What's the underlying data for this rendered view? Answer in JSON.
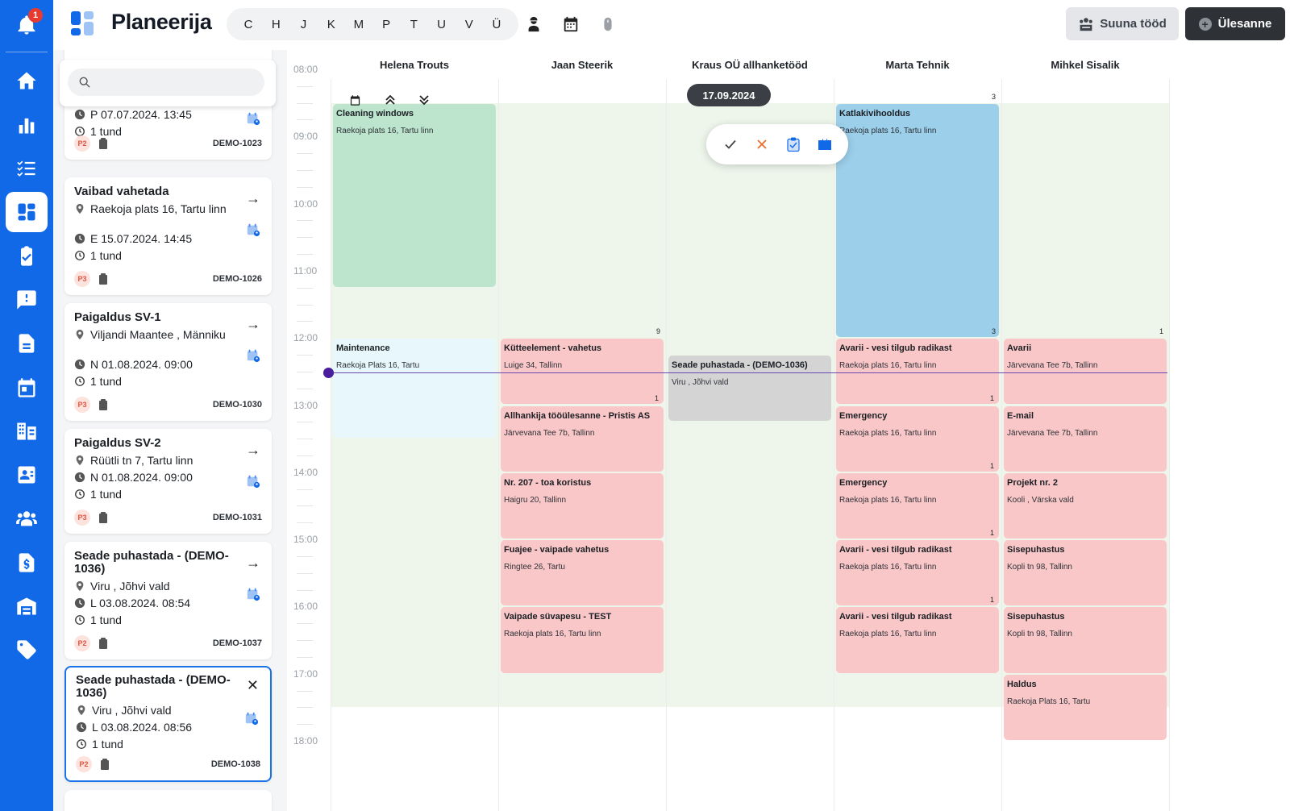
{
  "app": {
    "title": "Planeerija",
    "notification_count": "1"
  },
  "letters": [
    "C",
    "H",
    "J",
    "K",
    "M",
    "P",
    "T",
    "U",
    "V",
    "Ü"
  ],
  "toolbar": {
    "suuna_label": "Suuna tööd",
    "ulesanne_label": "Ülesanne"
  },
  "search": {
    "placeholder": ""
  },
  "tasks": [
    {
      "title": "",
      "address": "",
      "date": "P 07.07.2024. 13:45",
      "duration": "1 tund",
      "priority": "P2",
      "id": "DEMO-1023"
    },
    {
      "title": "Vaibad vahetada",
      "address": "Raekoja plats 16, Tartu linn",
      "date": "E 15.07.2024. 14:45",
      "duration": "1 tund",
      "priority": "P3",
      "id": "DEMO-1026"
    },
    {
      "title": "Paigaldus SV-1",
      "address": "Viljandi Maantee , Männiku",
      "date": "N 01.08.2024. 09:00",
      "duration": "1 tund",
      "priority": "P3",
      "id": "DEMO-1030"
    },
    {
      "title": "Paigaldus SV-2",
      "address": "Rüütli tn 7, Tartu linn",
      "date": "N 01.08.2024. 09:00",
      "duration": "1 tund",
      "priority": "P3",
      "id": "DEMO-1031"
    },
    {
      "title": "Seade puhastada - (DEMO-1036)",
      "address": "Viru , Jõhvi vald",
      "date": "L 03.08.2024. 08:54",
      "duration": "1 tund",
      "priority": "P2",
      "id": "DEMO-1037"
    },
    {
      "title": "Seade puhastada - (DEMO-1036)",
      "address": "Viru , Jõhvi vald",
      "date": "L 03.08.2024. 08:56",
      "duration": "1 tund",
      "priority": "P2",
      "id": "DEMO-1038"
    }
  ],
  "calendar": {
    "date": "17.09.2024",
    "times": [
      "08:00",
      "09:00",
      "10:00",
      "11:00",
      "12:00",
      "13:00",
      "14:00",
      "15:00",
      "16:00",
      "17:00",
      "18:00"
    ],
    "columns": [
      "Helena Trouts",
      "Jaan Steerik",
      "Kraus OÜ allhanketööd",
      "Marta Tehnik",
      "Mihkel Sisalik"
    ],
    "counts": {
      "top_marta": "3",
      "mid_jaan": "9",
      "mid_marta": "3",
      "mid_mihkel": "1"
    },
    "events": [
      {
        "col": 0,
        "start": 8.5,
        "end": 11.25,
        "color": "green",
        "title": "Cleaning windows",
        "address": "Raekoja plats 16, Tartu linn",
        "count": ""
      },
      {
        "col": 3,
        "start": 8.5,
        "end": 12.0,
        "color": "blue",
        "title": "Katlakivihooldus",
        "address": "Raekoja plats 16, Tartu linn",
        "count": ""
      },
      {
        "col": 0,
        "start": 12.0,
        "end": 13.5,
        "color": "lightblue",
        "title": "Maintenance",
        "address": "Raekoja Plats 16, Tartu",
        "count": ""
      },
      {
        "col": 1,
        "start": 12.0,
        "end": 13.0,
        "color": "red",
        "title": "Kütteelement - vahetus",
        "address": "Luige 34, Tallinn",
        "count": "1"
      },
      {
        "col": 1,
        "start": 13.0,
        "end": 14.0,
        "color": "red",
        "title": "Allhankija tööülesanne - Pristis AS",
        "address": "Järvevana Tee 7b, Tallinn",
        "count": ""
      },
      {
        "col": 1,
        "start": 14.0,
        "end": 15.0,
        "color": "red",
        "title": "Nr. 207 - toa koristus",
        "address": "Haigru 20, Tallinn",
        "count": ""
      },
      {
        "col": 1,
        "start": 15.0,
        "end": 16.0,
        "color": "red",
        "title": "Fuajee - vaipade vahetus",
        "address": "Ringtee 26, Tartu",
        "count": ""
      },
      {
        "col": 1,
        "start": 16.0,
        "end": 17.0,
        "color": "red",
        "title": "Vaipade süvapesu - TEST",
        "address": "Raekoja plats 16, Tartu linn",
        "count": ""
      },
      {
        "col": 2,
        "start": 12.25,
        "end": 13.25,
        "color": "gray",
        "title": "Seade puhastada - (DEMO-1036)",
        "address": "Viru , Jõhvi vald",
        "count": ""
      },
      {
        "col": 3,
        "start": 12.0,
        "end": 13.0,
        "color": "red",
        "title": "Avarii - vesi tilgub radikast",
        "address": "Raekoja plats 16, Tartu linn",
        "count": "1"
      },
      {
        "col": 3,
        "start": 13.0,
        "end": 14.0,
        "color": "red",
        "title": "Emergency",
        "address": "Raekoja plats 16, Tartu linn",
        "count": "1"
      },
      {
        "col": 3,
        "start": 14.0,
        "end": 15.0,
        "color": "red",
        "title": "Emergency",
        "address": "Raekoja plats 16, Tartu linn",
        "count": "1"
      },
      {
        "col": 3,
        "start": 15.0,
        "end": 16.0,
        "color": "red",
        "title": "Avarii - vesi tilgub radikast",
        "address": "Raekoja plats 16, Tartu linn",
        "count": "1"
      },
      {
        "col": 3,
        "start": 16.0,
        "end": 17.0,
        "color": "red",
        "title": "Avarii - vesi tilgub radikast",
        "address": "Raekoja plats 16, Tartu linn",
        "count": ""
      },
      {
        "col": 4,
        "start": 12.0,
        "end": 13.0,
        "color": "red",
        "title": "Avarii",
        "address": "Järvevana Tee 7b, Tallinn",
        "count": ""
      },
      {
        "col": 4,
        "start": 13.0,
        "end": 14.0,
        "color": "red",
        "title": "E-mail",
        "address": "Järvevana Tee 7b, Tallinn",
        "count": ""
      },
      {
        "col": 4,
        "start": 14.0,
        "end": 15.0,
        "color": "red",
        "title": "Projekt nr. 2",
        "address": "Kooli , Värska vald",
        "count": ""
      },
      {
        "col": 4,
        "start": 15.0,
        "end": 16.0,
        "color": "red",
        "title": "Sisepuhastus",
        "address": "Kopli tn 98, Tallinn",
        "count": ""
      },
      {
        "col": 4,
        "start": 16.0,
        "end": 17.0,
        "color": "red",
        "title": "Sisepuhastus",
        "address": "Kopli tn 98, Tallinn",
        "count": ""
      },
      {
        "col": 4,
        "start": 17.0,
        "end": 18.0,
        "color": "red",
        "title": "Haldus",
        "address": "Raekoja Plats 16, Tartu",
        "count": ""
      }
    ]
  },
  "colors": {
    "rail": "#1169e8",
    "event_red": "#f9c7c7",
    "event_green": "#bde4cc",
    "event_blue": "#9ccfea",
    "now_line": "#4a1c9e"
  }
}
